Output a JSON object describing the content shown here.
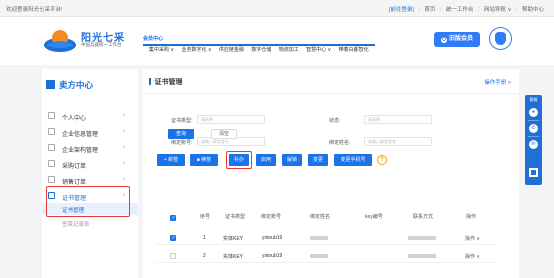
{
  "topbar": {
    "welcome": "欢迎登录阳光七采平台!",
    "login": "[前往登录]",
    "links": [
      "首页",
      "统一工作台",
      "网站导航 ∨",
      "帮助中心"
    ]
  },
  "brand": {
    "name": "阳光七采",
    "subtitle": "中国兵器统一工作台"
  },
  "nav": {
    "items": [
      "会员中心",
      "集中采购 ∨",
      "业务数字化 ∨",
      "供应链金融",
      "数字仓储",
      "物流加工",
      "智慧中心 ∨",
      "带着白都智化"
    ]
  },
  "header": {
    "old_member_button": "旧版会员",
    "old_member_icon": "O"
  },
  "sidebar": {
    "title": "卖方中心",
    "items": [
      {
        "label": "个人中心",
        "chev": "∨"
      },
      {
        "label": "企业信息管理",
        "chev": "∨"
      },
      {
        "label": "企业架构管理",
        "chev": "∨"
      },
      {
        "label": "采购订单",
        "chev": "∨"
      },
      {
        "label": "销售订单",
        "chev": "∨"
      },
      {
        "label": "证书管理",
        "chev": "∧"
      }
    ],
    "subitems": [
      "证书管理",
      "签章记录表"
    ]
  },
  "main": {
    "title": "证书管理",
    "manual": "操作手册 >",
    "filters": {
      "cert_type_label": "证书类型:",
      "cert_type_placeholder": "请选择",
      "status_label": "状态:",
      "status_placeholder": "请选择",
      "bind_account_label": "绑定账号:",
      "bind_account_placeholder": "请输入绑定账号",
      "bind_name_label": "绑定姓名:",
      "bind_name_placeholder": "请输入绑定姓名",
      "query": "查询",
      "clear": "清空"
    },
    "toolbar": [
      "+ 新签",
      "■ 续签",
      "补办",
      "启用",
      "解锁",
      "变更",
      "变更手机号"
    ],
    "help": "?",
    "columns": [
      "序号",
      "证书类型",
      "绑定账号",
      "绑定姓名",
      "key编号",
      "联系方式",
      "操作"
    ],
    "rows": [
      {
        "no": "1",
        "type": "实体KEY",
        "account": "ystoub19",
        "op": "操作 ∨",
        "checked": true
      },
      {
        "no": "2",
        "type": "实体KEY",
        "account": "ystoub19",
        "op": "操作 ∨",
        "checked": false
      }
    ]
  },
  "widget": {
    "label": "客服",
    "icons": [
      "person-icon",
      "phone-icon",
      "mail-icon",
      "qrcode-icon"
    ],
    "glyphs": [
      "●",
      "✆",
      "✉"
    ]
  },
  "colors": {
    "accent": "#1a73e8",
    "highlight": "#e53935"
  }
}
